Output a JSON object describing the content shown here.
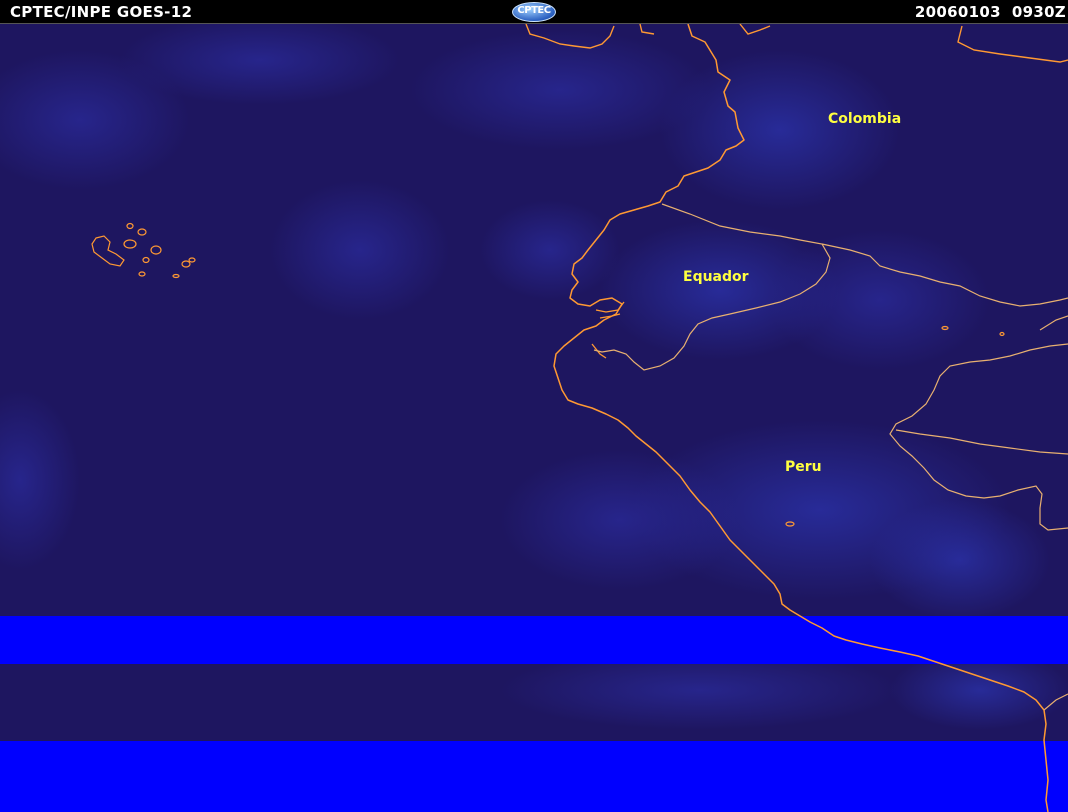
{
  "header": {
    "title": "CPTEC/INPE  GOES-12",
    "logo_text": "CPTEC",
    "timestamp": "20060103  0930Z"
  },
  "map_labels": {
    "colombia": "Colombia",
    "equador": "Equador",
    "peru": "Peru"
  },
  "colors": {
    "sea_background": "#1e1660",
    "coastline": "#ff9933",
    "country_label": "#ffff40",
    "no_data_band": "#0000ff"
  }
}
